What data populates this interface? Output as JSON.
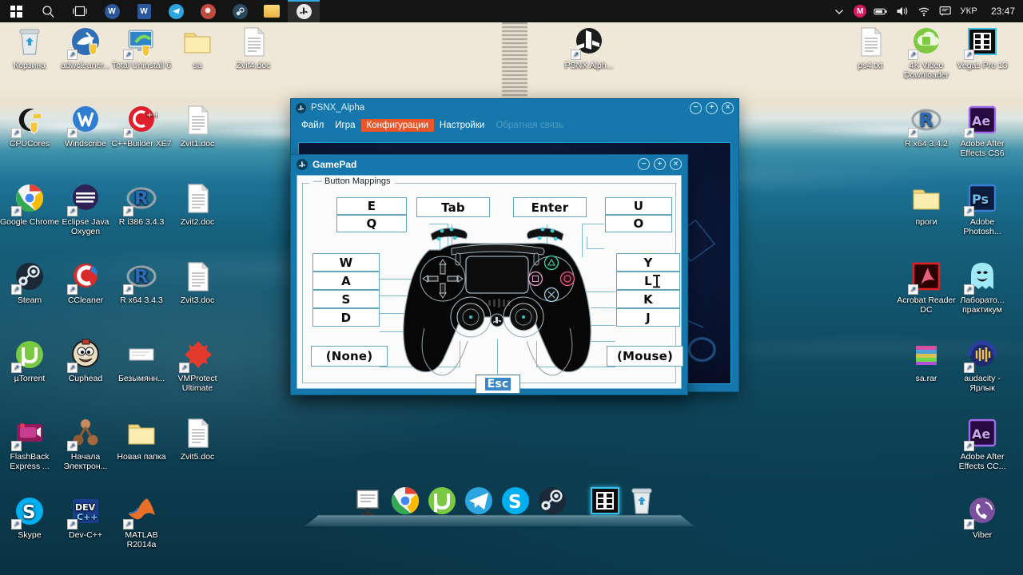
{
  "taskbar": {
    "start_label": "Start",
    "items": [
      {
        "name": "start-button",
        "icon": "windows-logo"
      },
      {
        "name": "search-button",
        "icon": "search-icon"
      },
      {
        "name": "task-view-button",
        "icon": "task-view-icon"
      },
      {
        "name": "taskbar-word-online",
        "icon": "word-circle-icon"
      },
      {
        "name": "taskbar-word",
        "icon": "word-icon"
      },
      {
        "name": "taskbar-telegram",
        "icon": "telegram-icon"
      },
      {
        "name": "taskbar-app",
        "icon": "rose-icon"
      },
      {
        "name": "taskbar-steam",
        "icon": "steam-icon"
      },
      {
        "name": "taskbar-explorer",
        "icon": "folder-icon"
      },
      {
        "name": "taskbar-psnx",
        "icon": "playstation-icon",
        "active": true
      }
    ],
    "tray": {
      "chevron": "chevron-up-icon",
      "mail_badge": "M",
      "battery": "battery-icon",
      "volume": "volume-icon",
      "wifi": "wifi-icon",
      "notifications": "notification-icon",
      "language": "УКР",
      "clock": "23:47"
    }
  },
  "desktop": {
    "icons_left": [
      {
        "label": "Корзина",
        "icon": "recycle-bin-icon",
        "col": 0,
        "row": 0
      },
      {
        "label": "adwcleaner...",
        "icon": "adwcleaner-icon",
        "col": 1,
        "row": 0
      },
      {
        "label": "Total Uninstall 6",
        "icon": "total-uninstall-icon",
        "col": 2,
        "row": 0
      },
      {
        "label": "sa",
        "icon": "folder-icon",
        "col": 3,
        "row": 0
      },
      {
        "label": "Zvit4.doc",
        "icon": "document-icon",
        "col": 4,
        "row": 0
      },
      {
        "label": "CPUCores",
        "icon": "cpucores-icon",
        "col": 0,
        "row": 1
      },
      {
        "label": "Windscribe",
        "icon": "windscribe-icon",
        "col": 1,
        "row": 1
      },
      {
        "label": "C++Builder XE7",
        "icon": "cpp-builder-icon",
        "col": 2,
        "row": 1
      },
      {
        "label": "Zvit1.doc",
        "icon": "document-icon",
        "col": 3,
        "row": 1
      },
      {
        "label": "Google Chrome",
        "icon": "chrome-icon",
        "col": 0,
        "row": 2
      },
      {
        "label": "Eclipse Java Oxygen",
        "icon": "eclipse-icon",
        "col": 1,
        "row": 2
      },
      {
        "label": "R i386 3.4.3",
        "icon": "r-icon",
        "col": 2,
        "row": 2
      },
      {
        "label": "Zvit2.doc",
        "icon": "document-icon",
        "col": 3,
        "row": 2
      },
      {
        "label": "Steam",
        "icon": "steam-icon",
        "col": 0,
        "row": 3
      },
      {
        "label": "CCleaner",
        "icon": "ccleaner-icon",
        "col": 1,
        "row": 3
      },
      {
        "label": "R x64 3.4.3",
        "icon": "r-icon",
        "col": 2,
        "row": 3
      },
      {
        "label": "Zvit3.doc",
        "icon": "document-icon",
        "col": 3,
        "row": 3
      },
      {
        "label": "µTorrent",
        "icon": "utorrent-icon",
        "col": 0,
        "row": 4
      },
      {
        "label": "Cuphead",
        "icon": "cuphead-icon",
        "col": 1,
        "row": 4
      },
      {
        "label": "Безымянн...",
        "icon": "notepad-icon",
        "col": 2,
        "row": 4
      },
      {
        "label": "VMProtect Ultimate",
        "icon": "vmprotect-icon",
        "col": 3,
        "row": 4
      },
      {
        "label": "FlashBack Express ...",
        "icon": "flashback-icon",
        "col": 0,
        "row": 5
      },
      {
        "label": "Начала Электрон...",
        "icon": "molecule-icon",
        "col": 1,
        "row": 5
      },
      {
        "label": "Новая папка",
        "icon": "folder-icon",
        "col": 2,
        "row": 5
      },
      {
        "label": "Zvit5.doc",
        "icon": "document-icon",
        "col": 3,
        "row": 5
      },
      {
        "label": "Skype",
        "icon": "skype-icon",
        "col": 0,
        "row": 6
      },
      {
        "label": "Dev-C++",
        "icon": "devcpp-icon",
        "col": 1,
        "row": 6
      },
      {
        "label": "MATLAB R2014a",
        "icon": "matlab-icon",
        "col": 2,
        "row": 6
      }
    ],
    "icons_center": [
      {
        "label": "PSNX Alph...",
        "icon": "playstation-icon"
      }
    ],
    "icons_right": [
      {
        "label": "ps4.txt",
        "icon": "document-icon",
        "col": 0,
        "row": 0
      },
      {
        "label": "4K Video Downloader",
        "icon": "4kvideo-icon",
        "col": 1,
        "row": 0
      },
      {
        "label": "Vegas Pro 13",
        "icon": "vegas-icon",
        "col": 2,
        "row": 0
      },
      {
        "label": "R x64 3.4.2",
        "icon": "r-icon",
        "col": 1,
        "row": 1
      },
      {
        "label": "Adobe After Effects CS6",
        "icon": "after-effects-icon",
        "col": 2,
        "row": 1
      },
      {
        "label": "проги",
        "icon": "folder-icon",
        "col": 1,
        "row": 2
      },
      {
        "label": "Adobe Photosh...",
        "icon": "photoshop-icon",
        "col": 2,
        "row": 2
      },
      {
        "label": "Acrobat Reader DC",
        "icon": "acrobat-icon",
        "col": 1,
        "row": 3
      },
      {
        "label": "Лаборато... практикум",
        "icon": "ghost-icon",
        "col": 2,
        "row": 3
      },
      {
        "label": "sa.rar",
        "icon": "winrar-icon",
        "col": 1,
        "row": 4
      },
      {
        "label": "audacity - Ярлык",
        "icon": "audacity-icon",
        "col": 2,
        "row": 4
      },
      {
        "label": "Adobe After Effects CC...",
        "icon": "after-effects-icon",
        "col": 2,
        "row": 5
      },
      {
        "label": "Viber",
        "icon": "viber-icon",
        "col": 2,
        "row": 6
      }
    ],
    "dock": [
      {
        "name": "dock-notepad",
        "icon": "notepad-window-icon"
      },
      {
        "name": "dock-chrome",
        "icon": "chrome-icon"
      },
      {
        "name": "dock-utorrent",
        "icon": "utorrent-icon"
      },
      {
        "name": "dock-telegram",
        "icon": "telegram-icon"
      },
      {
        "name": "dock-skype",
        "icon": "skype-icon"
      },
      {
        "name": "dock-steam",
        "icon": "steam-icon"
      },
      {
        "name": "dock-vegas",
        "icon": "vegas-icon"
      },
      {
        "name": "dock-recycle-bin",
        "icon": "recycle-bin-icon"
      }
    ]
  },
  "psnx_window": {
    "title": "PSNX_Alpha",
    "menu": [
      {
        "label": "Файл",
        "selected": false,
        "disabled": false
      },
      {
        "label": "Игра",
        "selected": false,
        "disabled": false
      },
      {
        "label": "Конфигурации",
        "selected": true,
        "disabled": false
      },
      {
        "label": "Настройки",
        "selected": false,
        "disabled": false
      },
      {
        "label": "Обратная связь",
        "selected": false,
        "disabled": true
      }
    ],
    "buttons": {
      "minimize": "−",
      "maximize": "+",
      "close": "×"
    },
    "accent_color": "#e8562a"
  },
  "gamepad_window": {
    "title": "GamePad",
    "group_label": "Button Mappings",
    "buttons": {
      "minimize": "−",
      "maximize": "+",
      "close": "×"
    },
    "mappings": {
      "l1": "E",
      "l2": "Q",
      "touchpad": "Tab",
      "options": "Enter",
      "r1": "U",
      "r2": "O",
      "dpad_up": "W",
      "dpad_left": "A",
      "dpad_down": "S",
      "dpad_right": "D",
      "left_stick": "(None)",
      "triangle": "Y",
      "circle": "L",
      "cross": "K",
      "square": "J",
      "right_stick": "(Mouse)",
      "ps_button": "Esc"
    },
    "highlighted_field": "L",
    "highlight_color": "#f4f08a",
    "selection_color": "#3d86c6"
  }
}
